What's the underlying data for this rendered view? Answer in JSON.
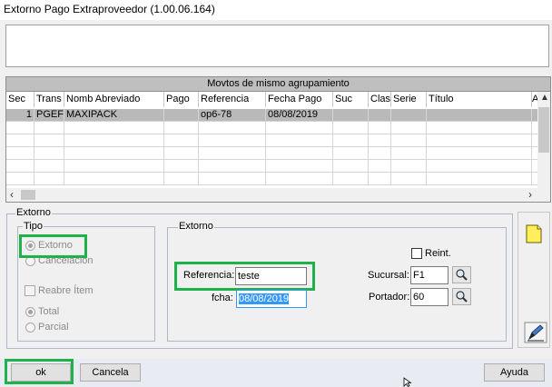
{
  "window": {
    "title": "Extorno Pago Extraproveedor (1.00.06.164)"
  },
  "grid": {
    "caption": "Movtos de mismo agrupamiento",
    "columns": [
      "Sec",
      "Trans",
      "Nomb Abreviado",
      "Pago",
      "Referencia",
      "Fecha Pago",
      "Suc",
      "Clas",
      "Serie",
      "Título",
      "A"
    ],
    "rows": [
      {
        "sec": "1",
        "trans": "PGEF",
        "nomb": "MAXIPACK",
        "pago": "",
        "referencia": "op6-78",
        "fecha": "08/08/2019",
        "suc": "",
        "clas": "",
        "serie": "",
        "titulo": ""
      }
    ]
  },
  "extorno_group": {
    "label": "Extorno"
  },
  "tipo": {
    "label": "Tipo",
    "options": [
      "Extorno",
      "Cancelación"
    ],
    "selected": "Extorno",
    "reabre_label": "Reabre Ítem",
    "scope_options": [
      "Total",
      "Parcial"
    ],
    "scope_selected": "Total"
  },
  "inner": {
    "label": "Extorno",
    "reint_label": "Reint.",
    "referencia_label": "Referencia:",
    "referencia_value": "teste",
    "fcha_label": "fcha:",
    "fcha_value": "08/08/2019",
    "sucursal_label": "Sucursal:",
    "sucursal_value": "F1",
    "portador_label": "Portador:",
    "portador_value": "60"
  },
  "buttons": {
    "ok": "ok",
    "cancel": "Cancela",
    "help": "Ayuda"
  },
  "colors": {
    "highlight": "#1fb24a",
    "selected_row": "#b9b9b9",
    "date_selection": "#3399ff"
  }
}
